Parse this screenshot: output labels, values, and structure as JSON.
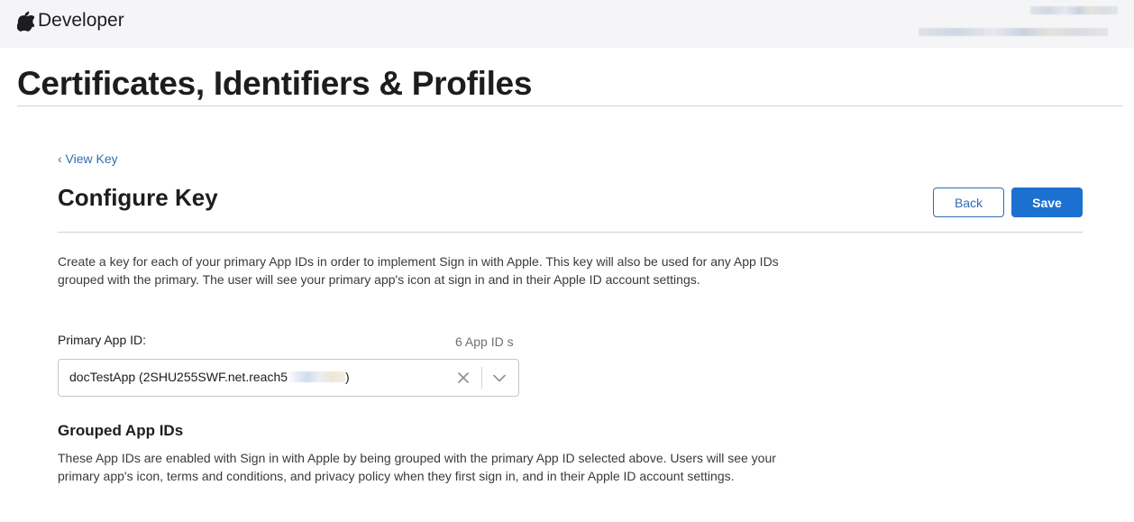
{
  "header": {
    "brand": "Developer",
    "apple_logo_icon": "apple-logo-icon"
  },
  "page": {
    "title": "Certificates, Identifiers & Profiles"
  },
  "main": {
    "back_link": "‹ View Key",
    "section_title": "Configure Key",
    "back_button": "Back",
    "save_button": "Save",
    "description": "Create a key for each of your primary App IDs in order to implement Sign in with Apple. This key will also be used for any App IDs grouped with the primary. The user will see your primary app's icon at sign in and in their Apple ID account settings.",
    "primary_app_id": {
      "label": "Primary App ID:",
      "count": "6 App ID s",
      "value_visible": "docTestApp (2SHU255SWF.net.reach5",
      "value_suffix": ")",
      "clear_icon": "close-icon",
      "dropdown_icon": "chevron-down-icon"
    },
    "grouped": {
      "heading": "Grouped App IDs",
      "description": "These App IDs are enabled with Sign in with Apple by being grouped with the primary App ID selected above. Users will see your primary app's icon, terms and conditions, and privacy policy when they first sign in, and in their Apple ID account settings."
    }
  },
  "colors": {
    "link": "#2f6db5",
    "primary_button": "#1c70d0",
    "header_bg": "#f5f5f7",
    "rule": "#d2d2d7"
  }
}
